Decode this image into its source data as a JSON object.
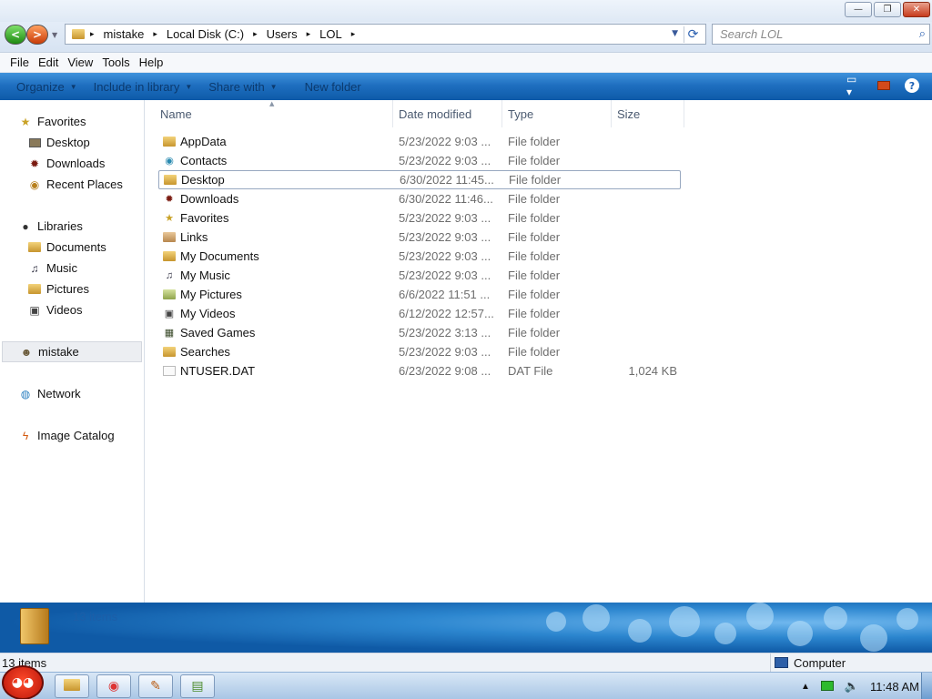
{
  "window": {
    "minimize_glyph": "—",
    "maximize_glyph": "❐",
    "close_glyph": "✕"
  },
  "address": {
    "crumbs": [
      "mistake",
      "Local Disk (C:)",
      "Users",
      "LOL"
    ],
    "separator": "▸",
    "search_placeholder": "Search LOL"
  },
  "menu": [
    "File",
    "Edit",
    "View",
    "Tools",
    "Help"
  ],
  "toolbar": {
    "organize": "Organize",
    "include_in_library": "Include in library",
    "share_with": "Share with",
    "new_folder": "New folder",
    "help_glyph": "?"
  },
  "sidebar": {
    "favorites": "Favorites",
    "favorites_items": [
      "Desktop",
      "Downloads",
      "Recent Places"
    ],
    "libraries": "Libraries",
    "libraries_items": [
      "Documents",
      "Music",
      "Pictures",
      "Videos"
    ],
    "user": "mistake",
    "network": "Network",
    "image_catalog": "Image Catalog"
  },
  "columns": {
    "name": "Name",
    "date": "Date modified",
    "type": "Type",
    "size": "Size"
  },
  "files": [
    {
      "name": "AppData",
      "date": "5/23/2022 9:03 ...",
      "type": "File folder",
      "size": ""
    },
    {
      "name": "Contacts",
      "date": "5/23/2022 9:03 ...",
      "type": "File folder",
      "size": ""
    },
    {
      "name": "Desktop",
      "date": "6/30/2022 11:45...",
      "type": "File folder",
      "size": ""
    },
    {
      "name": "Downloads",
      "date": "6/30/2022 11:46...",
      "type": "File folder",
      "size": ""
    },
    {
      "name": "Favorites",
      "date": "5/23/2022 9:03 ...",
      "type": "File folder",
      "size": ""
    },
    {
      "name": "Links",
      "date": "5/23/2022 9:03 ...",
      "type": "File folder",
      "size": ""
    },
    {
      "name": "My Documents",
      "date": "5/23/2022 9:03 ...",
      "type": "File folder",
      "size": ""
    },
    {
      "name": "My Music",
      "date": "5/23/2022 9:03 ...",
      "type": "File folder",
      "size": ""
    },
    {
      "name": "My Pictures",
      "date": "6/6/2022 11:51 ...",
      "type": "File folder",
      "size": ""
    },
    {
      "name": "My Videos",
      "date": "6/12/2022 12:57...",
      "type": "File folder",
      "size": ""
    },
    {
      "name": "Saved Games",
      "date": "5/23/2022 3:13 ...",
      "type": "File folder",
      "size": ""
    },
    {
      "name": "Searches",
      "date": "5/23/2022 9:03 ...",
      "type": "File folder",
      "size": ""
    },
    {
      "name": "NTUSER.DAT",
      "date": "6/23/2022 9:08 ...",
      "type": "DAT File",
      "size": "1,024 KB"
    }
  ],
  "details_pane": {
    "count": "13 items"
  },
  "status": {
    "left": "13 items",
    "right": "Computer"
  },
  "taskbar": {
    "clock": "11:48 AM"
  }
}
